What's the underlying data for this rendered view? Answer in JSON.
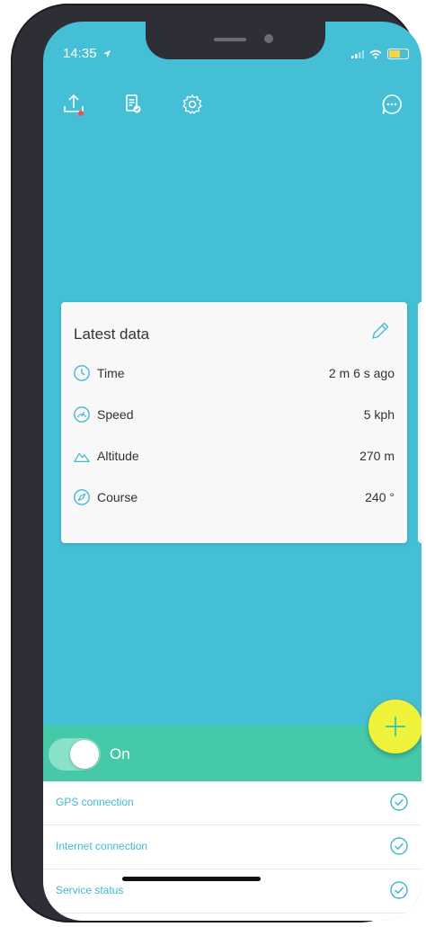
{
  "status_bar": {
    "time": "14:35",
    "location_icon": "location-arrow-icon",
    "signal_icon": "cellular-signal-icon",
    "wifi_icon": "wifi-icon",
    "battery_icon": "battery-icon"
  },
  "toolbar": {
    "left_icons": [
      "upload-icon",
      "clipboard-check-icon",
      "gear-icon"
    ],
    "right_icon": "chat-bubble-icon",
    "upload_has_badge": true
  },
  "card": {
    "title": "Latest data",
    "edit_icon": "pencil-icon",
    "rows": [
      {
        "icon": "clock-icon",
        "label": "Time",
        "value": "2 m 6 s ago"
      },
      {
        "icon": "speedometer-icon",
        "label": "Speed",
        "value": "5 kph"
      },
      {
        "icon": "mountain-icon",
        "label": "Altitude",
        "value": "270 m"
      },
      {
        "icon": "compass-icon",
        "label": "Course",
        "value": "240 °"
      }
    ]
  },
  "toggle": {
    "label": "On",
    "state": "on"
  },
  "fab": {
    "icon": "plus-icon"
  },
  "status_list": [
    {
      "label": "GPS connection",
      "icon": "check-circle-icon"
    },
    {
      "label": "Internet connection",
      "icon": "check-circle-icon"
    },
    {
      "label": "Service status",
      "icon": "check-circle-icon"
    }
  ],
  "colors": {
    "background": "#45bfd6",
    "toggle_bar": "#45c9a8",
    "fab": "#eef238",
    "link_text": "#43b8d2",
    "badge": "#e8534a"
  }
}
